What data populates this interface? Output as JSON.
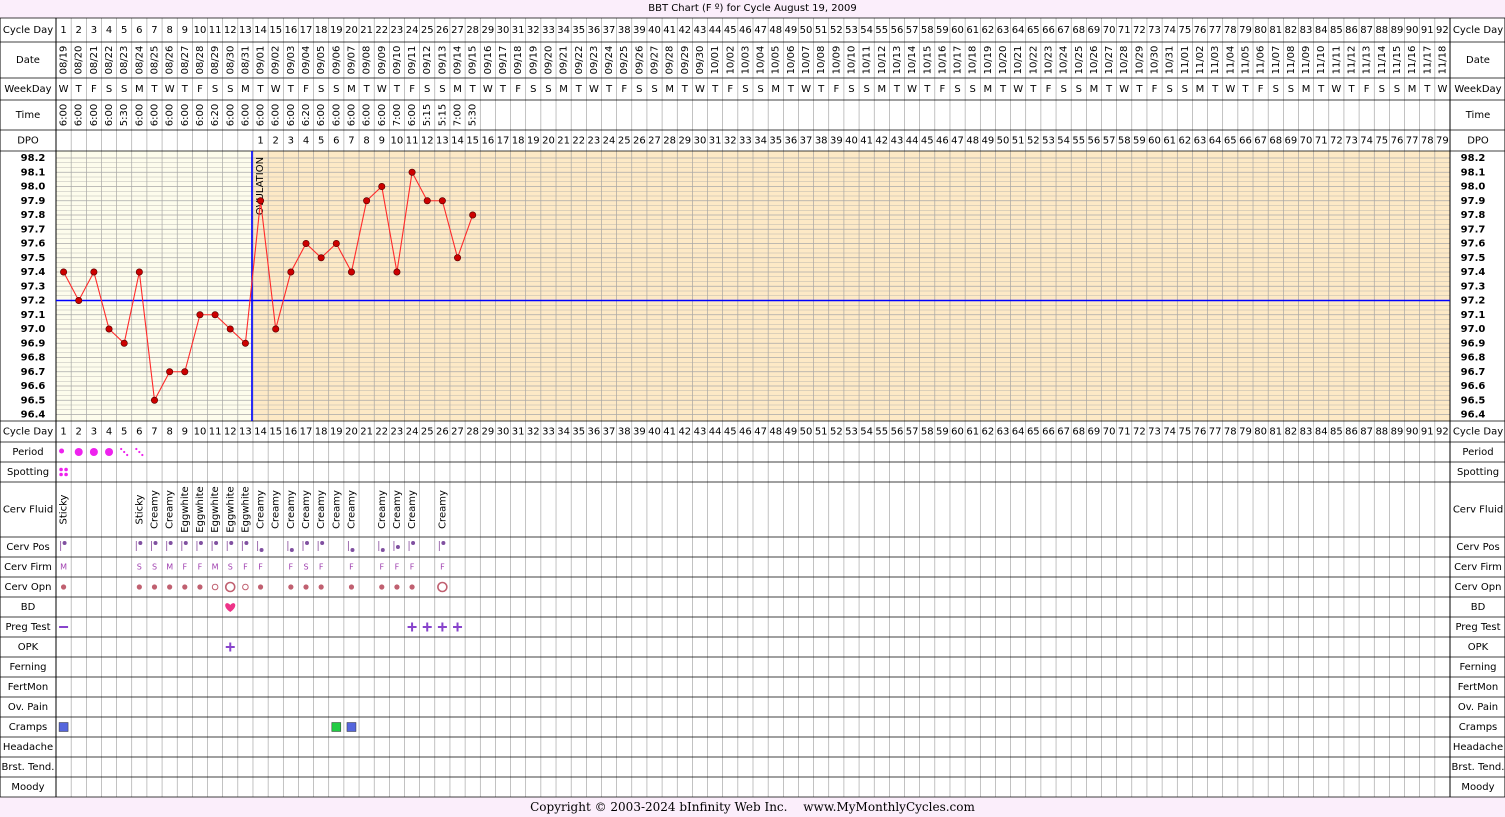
{
  "header": {
    "title": "BBT Chart (F º) for Cycle August 19, 2009"
  },
  "row_labels": {
    "cycle_day": "Cycle Day",
    "date": "Date",
    "weekday": "WeekDay",
    "time": "Time",
    "dpo": "DPO",
    "period": "Period",
    "spotting": "Spotting",
    "cerv_fluid": "Cerv Fluid",
    "cerv_pos": "Cerv Pos",
    "cerv_firm": "Cerv Firm",
    "cerv_opn": "Cerv Opn",
    "bd": "BD",
    "preg_test": "Preg Test",
    "opk": "OPK",
    "ferning": "Ferning",
    "fertmon": "FertMon",
    "ov_pain": "Ov. Pain",
    "cramps": "Cramps",
    "headache": "Headache",
    "brst_tend": "Brst. Tend.",
    "moody": "Moody"
  },
  "ovulation_label": "OVULATION",
  "cycle_days": [
    1,
    2,
    3,
    4,
    5,
    6,
    7,
    8,
    9,
    10,
    11,
    12,
    13,
    14,
    15,
    16,
    17,
    18,
    19,
    20,
    21,
    22,
    23,
    24,
    25,
    26,
    27,
    28,
    29,
    30,
    31,
    32,
    33,
    34,
    35,
    36,
    37,
    38,
    39,
    40,
    41,
    42,
    43,
    44,
    45,
    46,
    47,
    48,
    49,
    50,
    51,
    52,
    53,
    54,
    55,
    56,
    57,
    58,
    59,
    60,
    61,
    62,
    63,
    64,
    65,
    66,
    67,
    68,
    69,
    70,
    71,
    72,
    73,
    74,
    75,
    76,
    77,
    78,
    79,
    80,
    81,
    82,
    83,
    84,
    85,
    86,
    87,
    88,
    89,
    90,
    91,
    92
  ],
  "dates": [
    "08/19",
    "08/20",
    "08/21",
    "08/22",
    "08/23",
    "08/24",
    "08/25",
    "08/26",
    "08/27",
    "08/28",
    "08/29",
    "08/30",
    "08/31",
    "09/01",
    "09/02",
    "09/03",
    "09/04",
    "09/05",
    "09/06",
    "09/07",
    "09/08",
    "09/09",
    "09/10",
    "09/11",
    "09/12",
    "09/13",
    "09/14",
    "09/15",
    "09/16",
    "09/17",
    "09/18",
    "09/19",
    "09/20",
    "09/21",
    "09/22",
    "09/23",
    "09/24",
    "09/25",
    "09/26",
    "09/27",
    "09/28",
    "09/29",
    "09/30",
    "10/01",
    "10/02",
    "10/03",
    "10/04",
    "10/05",
    "10/06",
    "10/07",
    "10/08",
    "10/09",
    "10/10",
    "10/11",
    "10/12",
    "10/13",
    "10/14",
    "10/15",
    "10/16",
    "10/17",
    "10/18",
    "10/19",
    "10/20",
    "10/21",
    "10/22",
    "10/23",
    "10/24",
    "10/25",
    "10/26",
    "10/27",
    "10/28",
    "10/29",
    "10/30",
    "10/31",
    "11/01",
    "11/02",
    "11/03",
    "11/04",
    "11/05",
    "11/06",
    "11/07",
    "11/08",
    "11/09",
    "11/10",
    "11/11",
    "11/12",
    "11/13",
    "11/14",
    "11/15",
    "11/16",
    "11/17",
    "11/18"
  ],
  "weekdays": [
    "W",
    "T",
    "F",
    "S",
    "S",
    "M",
    "T",
    "W",
    "T",
    "F",
    "S",
    "S",
    "M",
    "T",
    "W",
    "T",
    "F",
    "S",
    "S",
    "M",
    "T",
    "W",
    "T",
    "F",
    "S",
    "S",
    "M",
    "T",
    "W",
    "T",
    "F",
    "S",
    "S",
    "M",
    "T",
    "W",
    "T",
    "F",
    "S",
    "S",
    "M",
    "T",
    "W",
    "T",
    "F",
    "S",
    "S",
    "M",
    "T",
    "W",
    "T",
    "F",
    "S",
    "S",
    "M",
    "T",
    "W",
    "T",
    "F",
    "S",
    "S",
    "M",
    "T",
    "W",
    "T",
    "F",
    "S",
    "S",
    "M",
    "T",
    "W",
    "T",
    "F",
    "S",
    "S",
    "M",
    "T",
    "W",
    "T",
    "F",
    "S",
    "S",
    "M",
    "T",
    "W",
    "T",
    "F",
    "S",
    "S",
    "M",
    "T",
    "W"
  ],
  "times": [
    "6:00",
    "6:00",
    "6:00",
    "6:00",
    "5:30",
    "6:00",
    "6:00",
    "6:00",
    "6:00",
    "6:00",
    "6:20",
    "6:00",
    "6:00",
    "6:00",
    "6:00",
    "6:00",
    "6:20",
    "6:00",
    "6:00",
    "6:00",
    "6:00",
    "6:00",
    "7:00",
    "6:00",
    "5:15",
    "5:15",
    "7:00",
    "5:30"
  ],
  "dpo": [
    1,
    2,
    3,
    4,
    5,
    6,
    7,
    8,
    9,
    10,
    11,
    12,
    13,
    14,
    15,
    16,
    17,
    18,
    19,
    20,
    21,
    22,
    23,
    24,
    25,
    26,
    27,
    28,
    29,
    30,
    31,
    32,
    33,
    34,
    35,
    36,
    37,
    38,
    39,
    40,
    41,
    42,
    43,
    44,
    45,
    46,
    47,
    48,
    49,
    50,
    51,
    52,
    53,
    54,
    55,
    56,
    57,
    58,
    59,
    60,
    61,
    62,
    63,
    64,
    65,
    66,
    67,
    68,
    69,
    70,
    71,
    72,
    73,
    74,
    75,
    76,
    77,
    78,
    79
  ],
  "temp_labels": [
    "98.2",
    "98.1",
    "98.0",
    "97.9",
    "97.8",
    "97.7",
    "97.6",
    "97.5",
    "97.4",
    "97.3",
    "97.2",
    "97.1",
    "97.0",
    "96.9",
    "96.8",
    "96.7",
    "96.6",
    "96.5",
    "96.4"
  ],
  "chart_data": {
    "type": "line",
    "title": "BBT Chart (F º) for Cycle August 19, 2009",
    "x": [
      1,
      2,
      3,
      4,
      5,
      6,
      7,
      8,
      9,
      10,
      11,
      12,
      13,
      14,
      15,
      16,
      17,
      18,
      19,
      20,
      21,
      22,
      23,
      24,
      25,
      26,
      27,
      28
    ],
    "y": [
      97.4,
      97.2,
      97.4,
      97.0,
      96.9,
      97.4,
      96.5,
      96.7,
      96.7,
      97.1,
      97.1,
      97.0,
      96.9,
      97.9,
      97.0,
      97.4,
      97.6,
      97.5,
      97.6,
      97.4,
      97.9,
      98.0,
      97.4,
      98.1,
      97.9,
      97.9,
      97.5,
      97.8
    ],
    "ylim": [
      96.4,
      98.2
    ],
    "xlim": [
      1,
      92
    ],
    "coverline": 97.2,
    "ovulation_day": 13,
    "grid": true,
    "legend": "none",
    "colors": {
      "line": "#ff2a2a",
      "point": "#cc0000",
      "coverline": "#0000ff",
      "pre_ovulation_bg": "#fdfcec",
      "post_ovulation_bg": "#fde9c6"
    }
  },
  "period": {
    "1": "light",
    "2": "heavy",
    "3": "heavy",
    "4": "heavy",
    "5": "spot",
    "6": "spot"
  },
  "spotting": {
    "1": "dots"
  },
  "cerv_fluid": {
    "1": "Sticky",
    "6": "Sticky",
    "7": "Creamy",
    "8": "Creamy",
    "9": "Eggwhite",
    "10": "Eggwhite",
    "11": "Eggwhite",
    "12": "Eggwhite",
    "13": "Eggwhite",
    "14": "Creamy",
    "15": "Creamy",
    "16": "Creamy",
    "17": "Creamy",
    "18": "Creamy",
    "19": "Creamy",
    "20": "Creamy",
    "22": "Creamy",
    "23": "Creamy",
    "24": "Creamy",
    "26": "Creamy"
  },
  "cerv_pos": {
    "1": "high",
    "6": "high",
    "7": "high",
    "8": "high",
    "9": "high",
    "10": "high",
    "11": "high",
    "12": "high",
    "13": "high",
    "14": "low",
    "16": "low",
    "17": "high",
    "18": "high",
    "20": "low",
    "22": "low",
    "23": "mid",
    "24": "high",
    "26": "high"
  },
  "cerv_firm": {
    "1": "M",
    "6": "S",
    "7": "S",
    "8": "M",
    "9": "F",
    "10": "F",
    "11": "M",
    "12": "S",
    "13": "F",
    "14": "F",
    "16": "F",
    "17": "S",
    "18": "F",
    "20": "F",
    "22": "F",
    "23": "F",
    "24": "F",
    "26": "F"
  },
  "cerv_opn": {
    "1": "dot",
    "6": "dot",
    "7": "dot",
    "8": "dot",
    "9": "dot",
    "10": "dot",
    "11": "small-ring",
    "12": "big-ring",
    "13": "small-ring",
    "14": "dot",
    "16": "dot",
    "17": "dot",
    "18": "dot",
    "20": "dot",
    "22": "dot",
    "23": "dot",
    "24": "dot",
    "26": "big-ring"
  },
  "bd": {
    "12": "heart"
  },
  "preg_test": {
    "1": "negative",
    "24": "positive",
    "25": "positive",
    "26": "positive",
    "27": "positive"
  },
  "opk": {
    "12": "positive"
  },
  "cramps": {
    "1": "#5566dd",
    "19": "#22cc44",
    "20": "#5566dd"
  },
  "footer": {
    "copyright": "Copyright © 2003-2024 bInfinity Web Inc.",
    "site": "www.MyMonthlyCycles.com"
  }
}
